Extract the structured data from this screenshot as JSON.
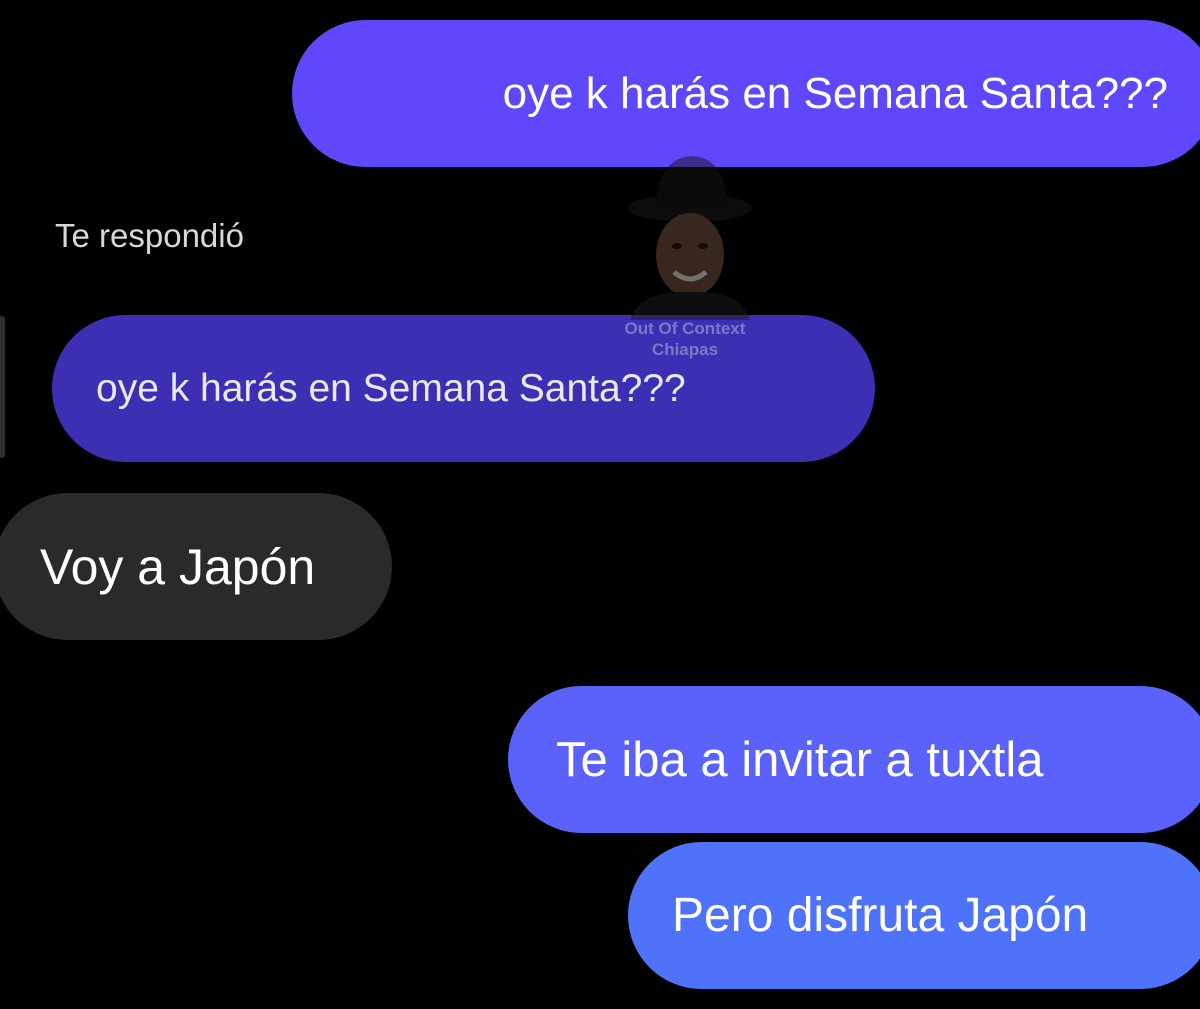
{
  "messages": [
    {
      "side": "sent",
      "text": "oye k harás en Semana Santa???"
    },
    {
      "side": "quoted-reply",
      "text": "oye k harás en Semana Santa???"
    },
    {
      "side": "received",
      "text": "Voy a Japón"
    },
    {
      "side": "sent",
      "text": "Te iba a invitar a tuxtla"
    },
    {
      "side": "sent",
      "text": "Pero disfruta Japón"
    }
  ],
  "reply_label": "Te respondió",
  "watermark": {
    "line1": "Out Of Context",
    "line2": "Chiapas"
  },
  "colors": {
    "background": "#000000",
    "sent_bubble": "#5f47fc",
    "quoted_bubble": "#3c2fb4",
    "received_bubble": "#2a2a2a"
  }
}
